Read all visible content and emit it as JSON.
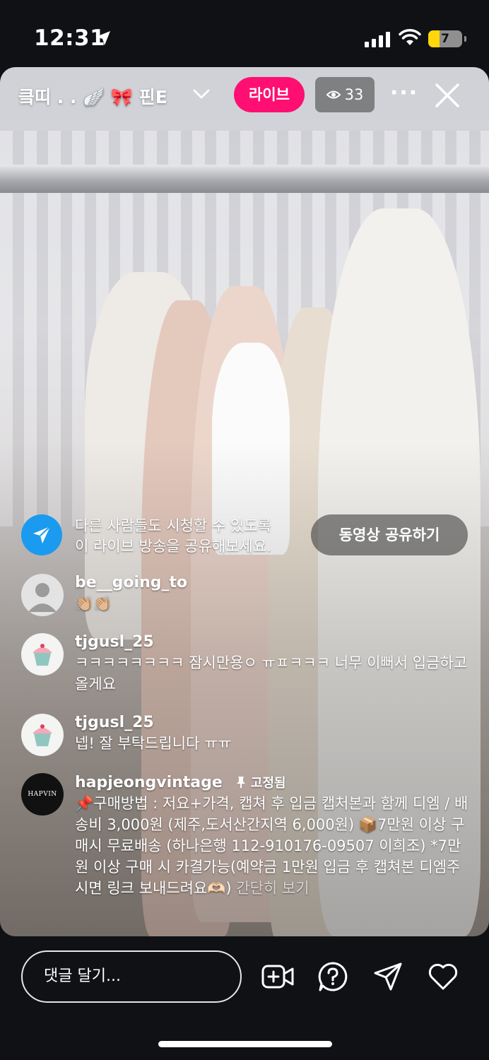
{
  "status_bar": {
    "time": "12:31",
    "battery": "7"
  },
  "header": {
    "account": "킄띠 . . 🪽 🎀 핀E",
    "live_label": "라이브",
    "viewer_count": "33"
  },
  "share_prompt": {
    "line1": "다른 사람들도 시청할 수 있도록",
    "line2": "이 라이브 방송을 공유해보세요.",
    "button": "동영상 공유하기"
  },
  "comments": [
    {
      "user": "be__going_to",
      "text": "👏🏼👏🏼"
    },
    {
      "user": "tjgusl_25",
      "text": "ㅋㅋㅋㅋㅋㅋㅋㅋ 잠시만용ㅇ ㅠㅍㅋㅋㅋ 너무 이뻐서 입금하고 올게요"
    },
    {
      "user": "tjgusl_25",
      "text": "넵! 잘 부탁드립니다 ㅠㅠ"
    }
  ],
  "pinned": {
    "user": "hapjeongvintage",
    "pinned_label": "고정됨",
    "avatar_text": "HAPVIN",
    "text": "📌구매방법 : 저요+가격, 캡쳐 후 입금 캡처본과 함께 디엠 / 배송비 3,000원 (제주,도서산간지역 6,000원) 📦7만원 이상 구매시 무료배송 (하나은행 112-910176-09507 이희조) *7만원 이상 구매 시 카결가능(예약금 1만원 입금 후 캡쳐본 디엠주시면 링크 보내드려요🫶🏻)",
    "see_more": "간단히 보기"
  },
  "bottom_bar": {
    "comment_placeholder": "댓글 달기..."
  }
}
